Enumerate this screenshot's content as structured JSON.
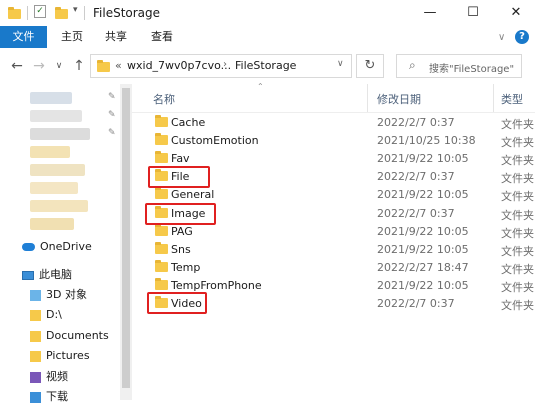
{
  "window": {
    "title": "FileStorage",
    "buttons": {
      "minimize": "—",
      "maximize": "☐",
      "close": "✕"
    }
  },
  "ribbon": {
    "tabs": [
      "文件",
      "主页",
      "共享",
      "查看"
    ],
    "help": "?"
  },
  "address": {
    "prefix": "«",
    "parent": "wxid_7wv0p7cvo...",
    "current": "FileStorage",
    "search_placeholder": "搜索\"FileStorage\""
  },
  "nav": {
    "onedrive": "OneDrive",
    "thispc": "此电脑",
    "items": [
      "3D 对象",
      "D:\\",
      "Documents",
      "Pictures",
      "视频",
      "下载"
    ]
  },
  "columns": {
    "name": "名称",
    "modified": "修改日期",
    "type": "类型"
  },
  "files": [
    {
      "name": "Cache",
      "date": "2022/2/7 0:37",
      "type": "文件夹"
    },
    {
      "name": "CustomEmotion",
      "date": "2021/10/25 10:38",
      "type": "文件夹"
    },
    {
      "name": "Fav",
      "date": "2021/9/22 10:05",
      "type": "文件夹"
    },
    {
      "name": "File",
      "date": "2022/2/7 0:37",
      "type": "文件夹"
    },
    {
      "name": "General",
      "date": "2021/9/22 10:05",
      "type": "文件夹"
    },
    {
      "name": "Image",
      "date": "2022/2/7 0:37",
      "type": "文件夹"
    },
    {
      "name": "PAG",
      "date": "2021/9/22 10:05",
      "type": "文件夹"
    },
    {
      "name": "Sns",
      "date": "2021/9/22 10:05",
      "type": "文件夹"
    },
    {
      "name": "Temp",
      "date": "2022/2/27 18:47",
      "type": "文件夹"
    },
    {
      "name": "TempFromPhone",
      "date": "2021/9/22 10:05",
      "type": "文件夹"
    },
    {
      "name": "Video",
      "date": "2022/2/7 0:37",
      "type": "文件夹"
    }
  ],
  "colors": {
    "accent": "#1979ca",
    "folder": "#f6c94a",
    "highlight": "#e02020"
  }
}
